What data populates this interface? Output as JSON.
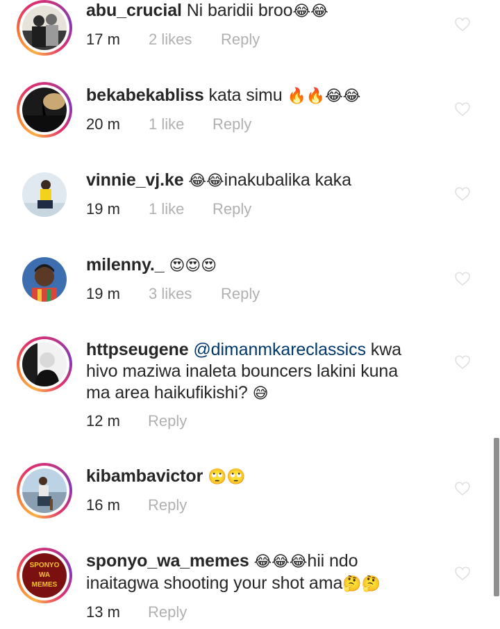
{
  "comments": [
    {
      "username": "abu_crucial",
      "text": "Ni baridii broo",
      "emoji": "😂😂",
      "time": "17 m",
      "likes": "2 likes",
      "reply": "Reply",
      "avatar_icon": "avatar-photo",
      "story_ring": true
    },
    {
      "username": "bekabekabliss",
      "text": "kata simu",
      "emoji": "🔥🔥😂😂",
      "time": "20 m",
      "likes": "1 like",
      "reply": "Reply",
      "avatar_icon": "avatar-photo",
      "story_ring": true
    },
    {
      "username": "vinnie_vj.ke",
      "emoji": "😂😂",
      "text": "inakubalika kaka",
      "time": "19 m",
      "likes": "1 like",
      "reply": "Reply",
      "avatar_icon": "avatar-photo",
      "story_ring": false
    },
    {
      "username": "milenny._",
      "text": "",
      "emoji": "😍😍😍",
      "time": "19 m",
      "likes": "3 likes",
      "reply": "Reply",
      "avatar_icon": "avatar-photo",
      "story_ring": false
    },
    {
      "username": "httpseugene",
      "mention": "@dimanmkareclassics",
      "text_line1_rest": "kwa",
      "text_line2": "hivo maziwa inaleta bouncers lakini kuna",
      "text_line3": "ma area haikufikishi?",
      "emoji": "😅",
      "time": "12 m",
      "reply": "Reply",
      "avatar_icon": "avatar-photo",
      "story_ring": true
    },
    {
      "username": "kibambavictor",
      "text": "",
      "emoji": "🙄🙄",
      "time": "16 m",
      "reply": "Reply",
      "avatar_icon": "avatar-photo",
      "story_ring": true
    },
    {
      "username": "sponyo_wa_memes",
      "emoji": "😂😂😂",
      "text_line1_rest": "hii ndo",
      "text_line2": "inaitagwa shooting your shot ama",
      "emoji2": "🤔🤔",
      "time": "13 m",
      "reply": "Reply",
      "avatar_icon": "avatar-logo",
      "avatar_logo_text": [
        "SPONYO",
        "WA",
        "MEMES"
      ],
      "story_ring": true
    }
  ],
  "colors": {
    "username": "#262626",
    "mention": "#00376b",
    "meta_muted": "#b0b0b0",
    "heart_outline": "#e0e0e0",
    "story_ring_start": "#fcaf45",
    "story_ring_end": "#833ab4"
  },
  "icons": {
    "like": "heart-outline-icon"
  }
}
